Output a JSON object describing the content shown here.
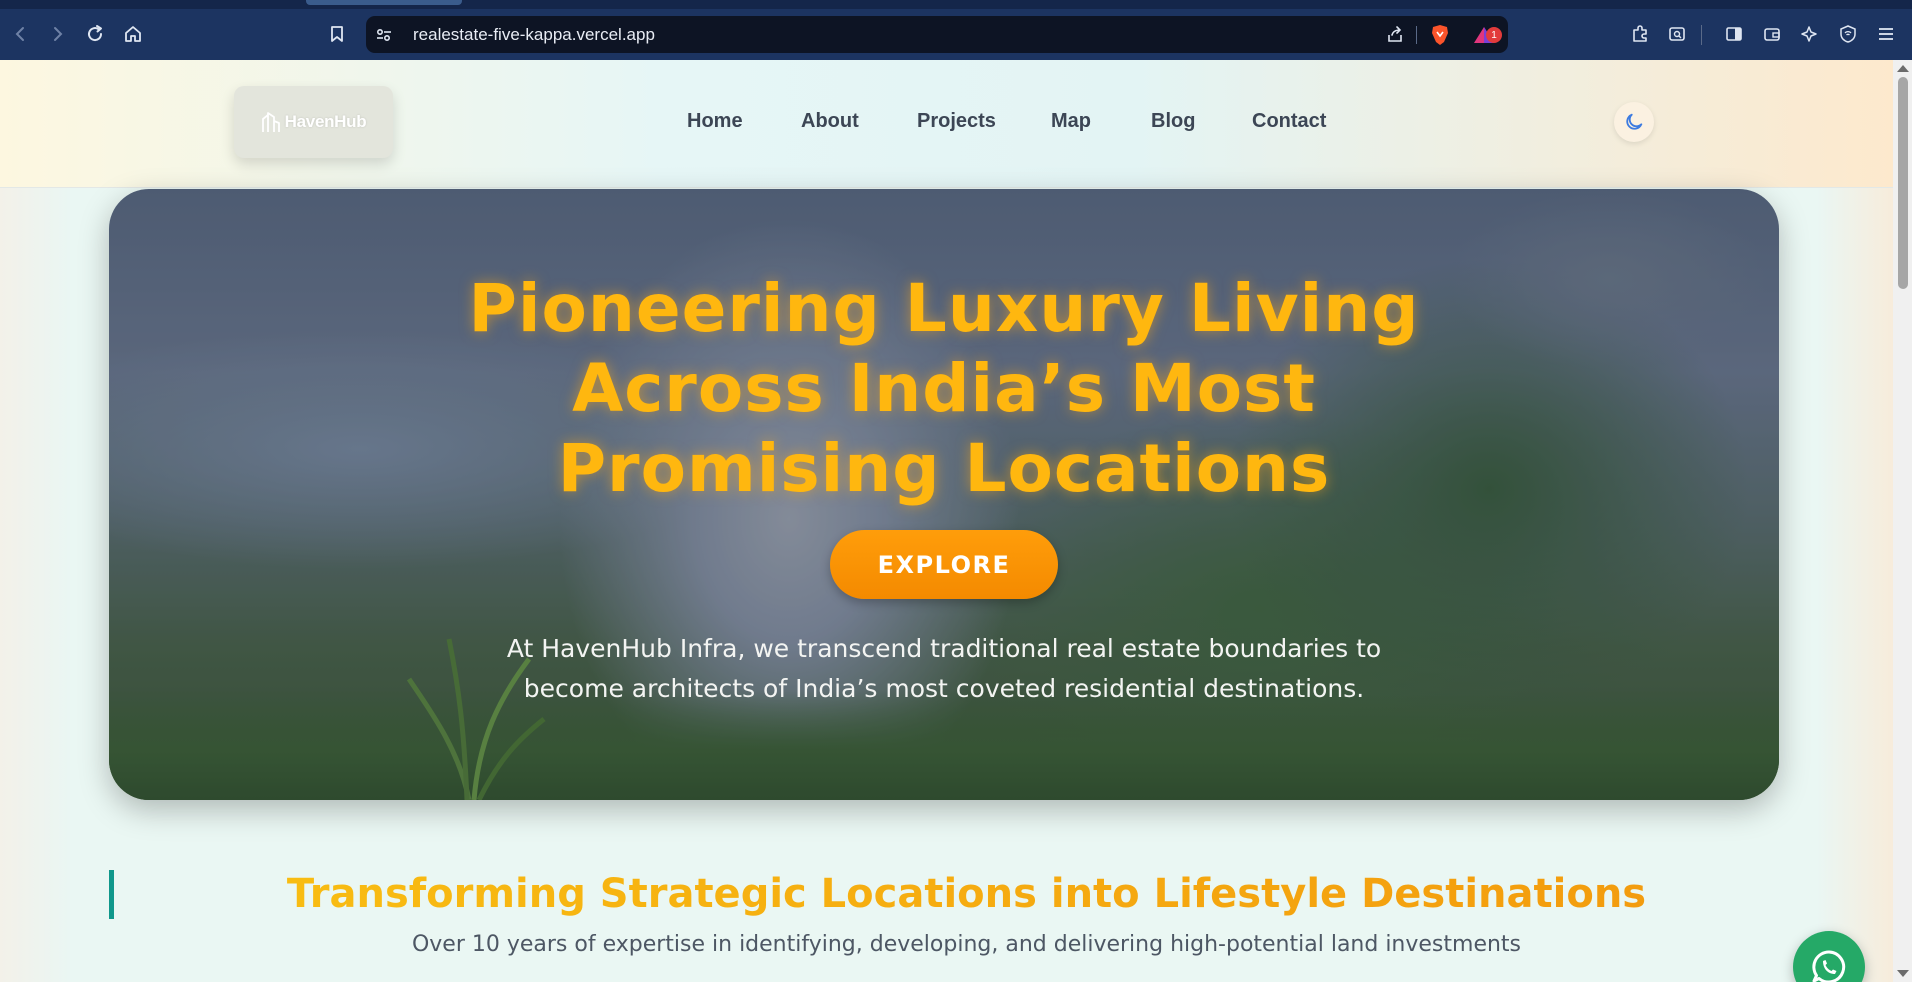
{
  "browser": {
    "url": "realestate-five-kappa.vercel.app",
    "notification_count": "1"
  },
  "navbar": {
    "logo_text": "HavenHub",
    "links": [
      "Home",
      "About",
      "Projects",
      "Map",
      "Blog",
      "Contact"
    ]
  },
  "hero": {
    "title_lines": [
      "Pioneering Luxury Living",
      "Across India’s Most",
      "Promising Locations"
    ],
    "button_label": "EXPLORE",
    "description_lines": [
      "At HavenHub Infra, we transcend traditional real estate boundaries to",
      "become architects of India’s most coveted residential destinations."
    ]
  },
  "section": {
    "title": "Transforming Strategic Locations into Lifestyle Destinations",
    "subtitle": "Over 10 years of expertise in identifying, developing, and delivering high-potential land investments"
  },
  "colors": {
    "accent_orange": "#f48a00",
    "title_gold": "#ffb70f",
    "teal_bar": "#10988b",
    "whatsapp_green": "#25a967",
    "browser_toolbar": "#1c3461"
  },
  "icons": {
    "theme_toggle": "moon-icon",
    "floating_chat": "whatsapp-icon"
  }
}
